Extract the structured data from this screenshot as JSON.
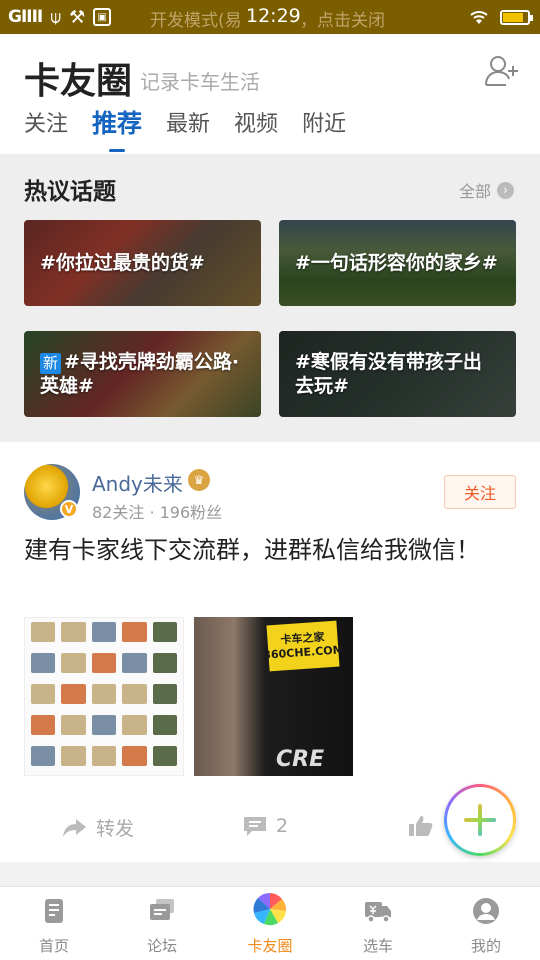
{
  "status_bar": {
    "signal": "GIIII",
    "notice": "开发模式(易",
    "notice_tail": "，点击关闭",
    "time": "12:29",
    "battery_level": 0.85
  },
  "header": {
    "title": "卡友圈",
    "subtitle": "记录卡车生活",
    "tabs": [
      {
        "label": "关注",
        "active": false
      },
      {
        "label": "推荐",
        "active": true
      },
      {
        "label": "最新",
        "active": false
      },
      {
        "label": "视频",
        "active": false
      },
      {
        "label": "附近",
        "active": false
      }
    ]
  },
  "topics": {
    "title": "热议话题",
    "all_label": "全部",
    "items": [
      {
        "text": "#你拉过最贵的货#"
      },
      {
        "text": "#一句话形容你的家乡#"
      },
      {
        "badge": "新",
        "text": "#寻找壳牌劲霸公路·英雄#"
      },
      {
        "text": "#寒假有没有带孩子出去玩#"
      }
    ]
  },
  "post": {
    "user_name": "Andy未来",
    "verified_badge": "V",
    "meta": "82关注 · 196粉丝",
    "follow_label": "关注",
    "text": "建有卡家线下交流群，进群私信给我微信！",
    "image2_label": "卡车之家\n360CHE.COM",
    "image2_logo": "CRE",
    "share_label": "转发",
    "comment_count": "2"
  },
  "bottom_nav": [
    {
      "label": "首页",
      "icon": "document-icon",
      "active": false
    },
    {
      "label": "论坛",
      "icon": "chat-icon",
      "active": false
    },
    {
      "label": "卡友圈",
      "icon": "pinwheel-icon",
      "active": true
    },
    {
      "label": "选车",
      "icon": "truck-icon",
      "active": false
    },
    {
      "label": "我的",
      "icon": "user-icon",
      "active": false
    }
  ],
  "colors": {
    "accent_blue": "#1565c0",
    "follow_orange": "#f05a24",
    "nav_active": "#f08a1a",
    "status_bar": "#7b5e00"
  }
}
